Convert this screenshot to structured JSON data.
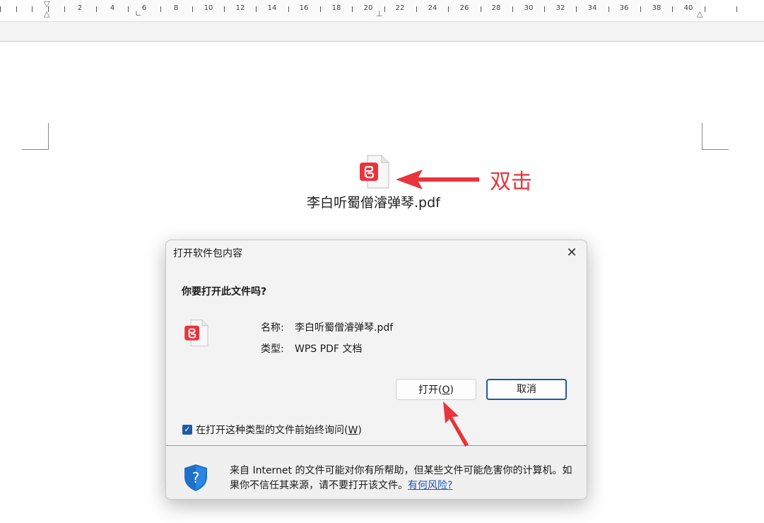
{
  "ruler": {
    "numbers": [
      "2",
      "4",
      "6",
      "8",
      "10",
      "12",
      "14",
      "16",
      "18",
      "20",
      "22",
      "24",
      "26",
      "28",
      "30",
      "32",
      "34",
      "36",
      "38",
      "40"
    ]
  },
  "document": {
    "filename": "李白听蜀僧濬弹琴.pdf",
    "annotation": "双击",
    "annotation_color": "#e8343b",
    "file_icon": "wps-pdf-icon"
  },
  "dialog": {
    "title": "打开软件包内容",
    "close_glyph": "✕",
    "question": "你要打开此文件吗?",
    "name_label": "名称:",
    "name_value": "李白听蜀僧濬弹琴.pdf",
    "type_label": "类型:",
    "type_value": "WPS PDF 文档",
    "open_button_pre": "打开(",
    "open_button_key": "O",
    "open_button_post": ")",
    "cancel_button": "取消",
    "checkbox_checked": true,
    "checkbox_pre": "在打开这种类型的文件前始终询问(",
    "checkbox_key": "W",
    "checkbox_post": ")",
    "warning_text": "来自 Internet 的文件可能对你有所帮助，但某些文件可能危害你的计算机。如果你不信任其来源，请不要打开该文件。",
    "risk_link": "有何风险?",
    "accent_color": "#1f5aa6"
  }
}
